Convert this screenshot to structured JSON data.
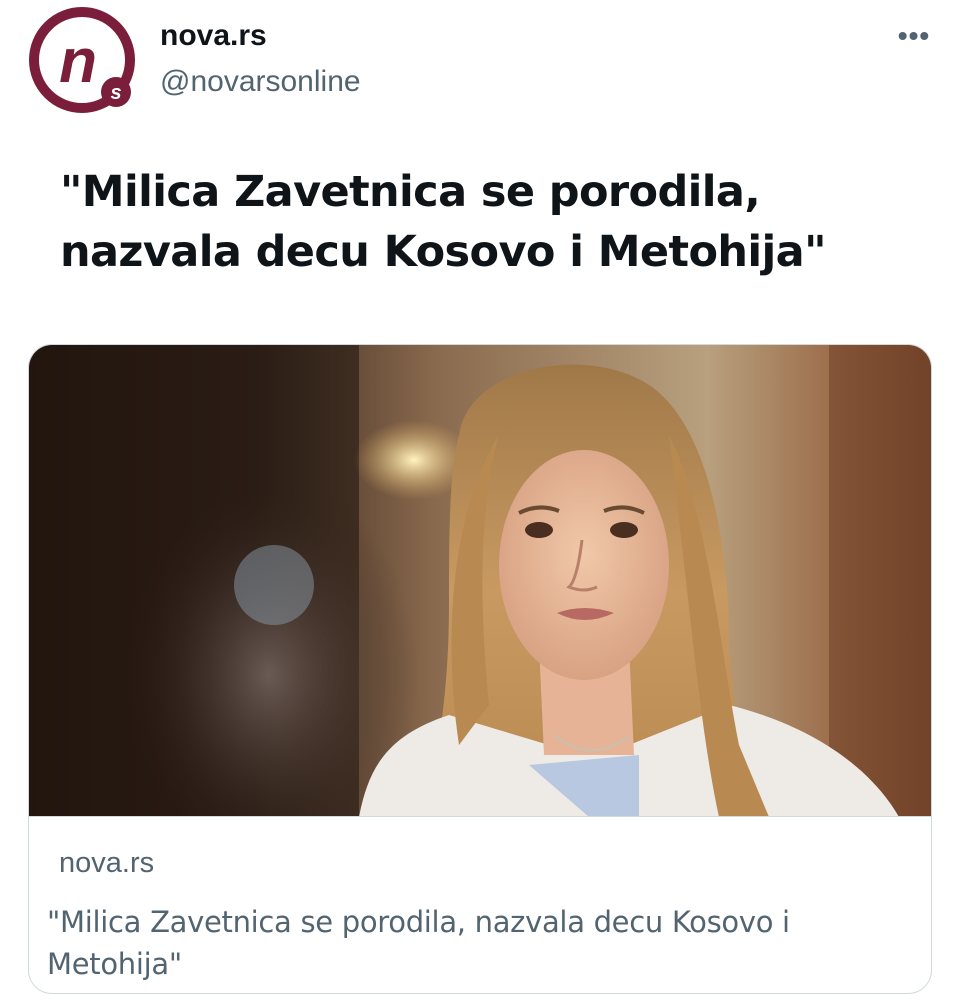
{
  "tweet": {
    "author": {
      "display_name": "nova.rs",
      "handle": "@novarsonline",
      "avatar_icon": "nova-s-logo-icon",
      "avatar_logo_letters": "n s",
      "brand_color": "#7a1e3c"
    },
    "more_icon": "more-dots-icon",
    "more_label": "•••",
    "text": "\"Milica Zavetnica se porodila, nazvala decu Kosovo i Metohija\"",
    "card": {
      "image_icon": "news-photo-woman-icon",
      "domain": "nova.rs",
      "title": "\"Milica Zavetnica se porodila, nazvala decu Kosovo i Metohija\""
    }
  }
}
